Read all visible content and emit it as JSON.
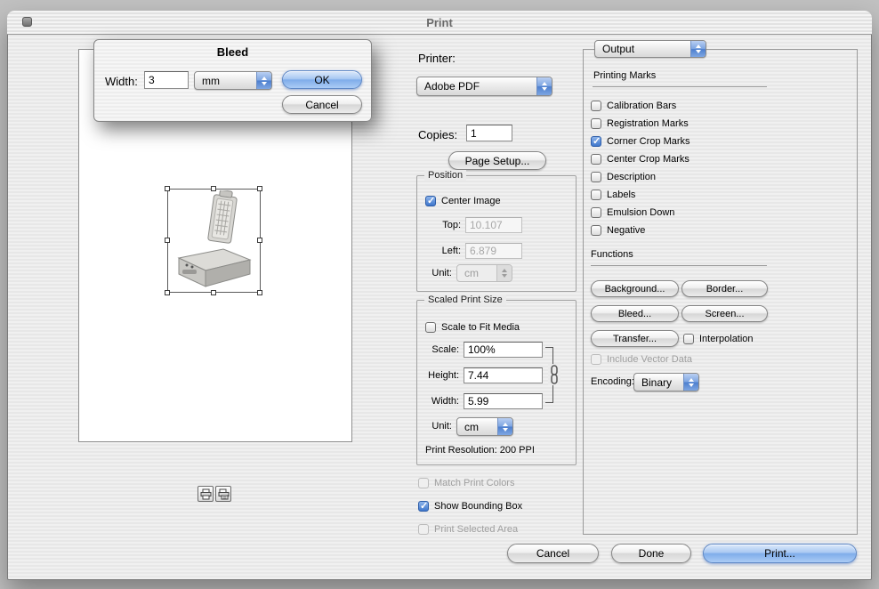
{
  "window": {
    "title": "Print",
    "footer": {
      "cancel": "Cancel",
      "done": "Done",
      "print": "Print..."
    }
  },
  "printer": {
    "label": "Printer:",
    "value": "Adobe PDF"
  },
  "copies": {
    "label": "Copies:",
    "value": "1"
  },
  "page_setup": "Page Setup...",
  "position": {
    "legend": "Position",
    "center_image": {
      "label": "Center Image",
      "checked": true,
      "disabled": false
    },
    "top": {
      "label": "Top:",
      "value": "10.107",
      "disabled": true
    },
    "left": {
      "label": "Left:",
      "value": "6.879",
      "disabled": true
    },
    "unit": {
      "label": "Unit:",
      "value": "cm",
      "disabled": true
    }
  },
  "scaled": {
    "legend": "Scaled Print Size",
    "scale_to_fit": {
      "label": "Scale to Fit Media",
      "checked": false,
      "disabled": false
    },
    "scale": {
      "label": "Scale:",
      "value": "100%"
    },
    "height": {
      "label": "Height:",
      "value": "7.44"
    },
    "width": {
      "label": "Width:",
      "value": "5.99"
    },
    "unit": {
      "label": "Unit:",
      "value": "cm",
      "disabled": false
    },
    "resolution": "Print Resolution: 200 PPI"
  },
  "preview_options": {
    "match_print_colors": {
      "label": "Match Print Colors",
      "checked": false,
      "disabled": true
    },
    "show_bounding_box": {
      "label": "Show Bounding Box",
      "checked": true,
      "disabled": false
    },
    "print_selected_area": {
      "label": "Print Selected Area",
      "checked": false,
      "disabled": true
    }
  },
  "output_panel": {
    "mode": "Output",
    "printing_marks_label": "Printing Marks",
    "marks": [
      {
        "label": "Calibration Bars",
        "checked": false
      },
      {
        "label": "Registration Marks",
        "checked": false
      },
      {
        "label": "Corner Crop Marks",
        "checked": true
      },
      {
        "label": "Center Crop Marks",
        "checked": false
      },
      {
        "label": "Description",
        "checked": false
      },
      {
        "label": "Labels",
        "checked": false
      },
      {
        "label": "Emulsion Down",
        "checked": false
      },
      {
        "label": "Negative",
        "checked": false
      }
    ],
    "functions_label": "Functions",
    "buttons": [
      "Background...",
      "Border...",
      "Bleed...",
      "Screen...",
      "Transfer..."
    ],
    "interpolation": {
      "label": "Interpolation",
      "checked": false,
      "disabled": false
    },
    "include_vector_data": {
      "label": "Include Vector Data",
      "checked": false,
      "disabled": true
    },
    "encoding": {
      "label": "Encoding:",
      "value": "Binary"
    }
  },
  "bleed_dialog": {
    "title": "Bleed",
    "width": {
      "label": "Width:",
      "value": "3"
    },
    "unit": "mm",
    "ok": "OK",
    "cancel": "Cancel"
  },
  "colors": {
    "aqua_blue": "#3f77cc",
    "window_bg": "#ececec",
    "desktop_bg": "#c1c1c1"
  },
  "icons": {
    "window_close": "rounded-square-widget",
    "popup_arrows": "up-down-triangles",
    "chain_link": "two-linked-ovals",
    "printer_left": "printer",
    "printer_right": "printer-with-pages",
    "bounding_handle": "small-square"
  }
}
